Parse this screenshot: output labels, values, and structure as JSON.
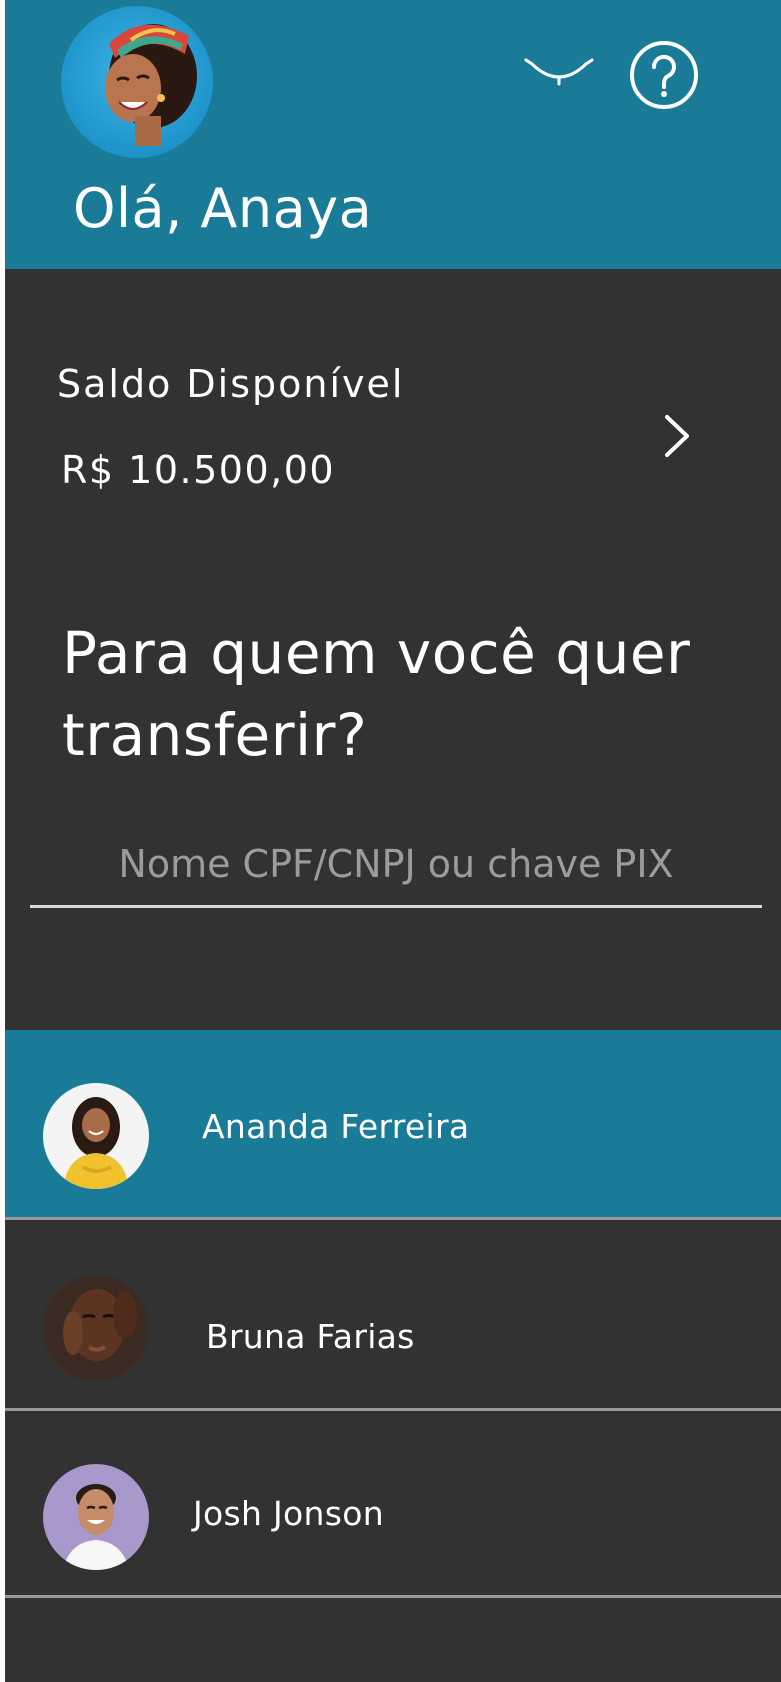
{
  "header": {
    "greeting": "Olá, Anaya",
    "icons": {
      "avatar": "user-avatar-anaya",
      "visibility": "eye-closed-icon",
      "help": "question-circle-icon"
    }
  },
  "balance": {
    "label": "Saldo Disponível",
    "value": "R$ 10.500,00",
    "icon": "chevron-right-icon"
  },
  "transfer": {
    "question": "Para quem você quer transferir?"
  },
  "search": {
    "placeholder": "Nome CPF/CNPJ ou chave PIX",
    "value": ""
  },
  "contacts": [
    {
      "name": "Ananda Ferreira",
      "selected": true
    },
    {
      "name": "Bruna Farias",
      "selected": false
    },
    {
      "name": "Josh Jonson",
      "selected": false
    }
  ],
  "colors": {
    "brand": "#1a7b98",
    "background": "#323232",
    "text": "#ffffff",
    "placeholder": "#9c9c9c",
    "divider": "#9a9a9a"
  }
}
